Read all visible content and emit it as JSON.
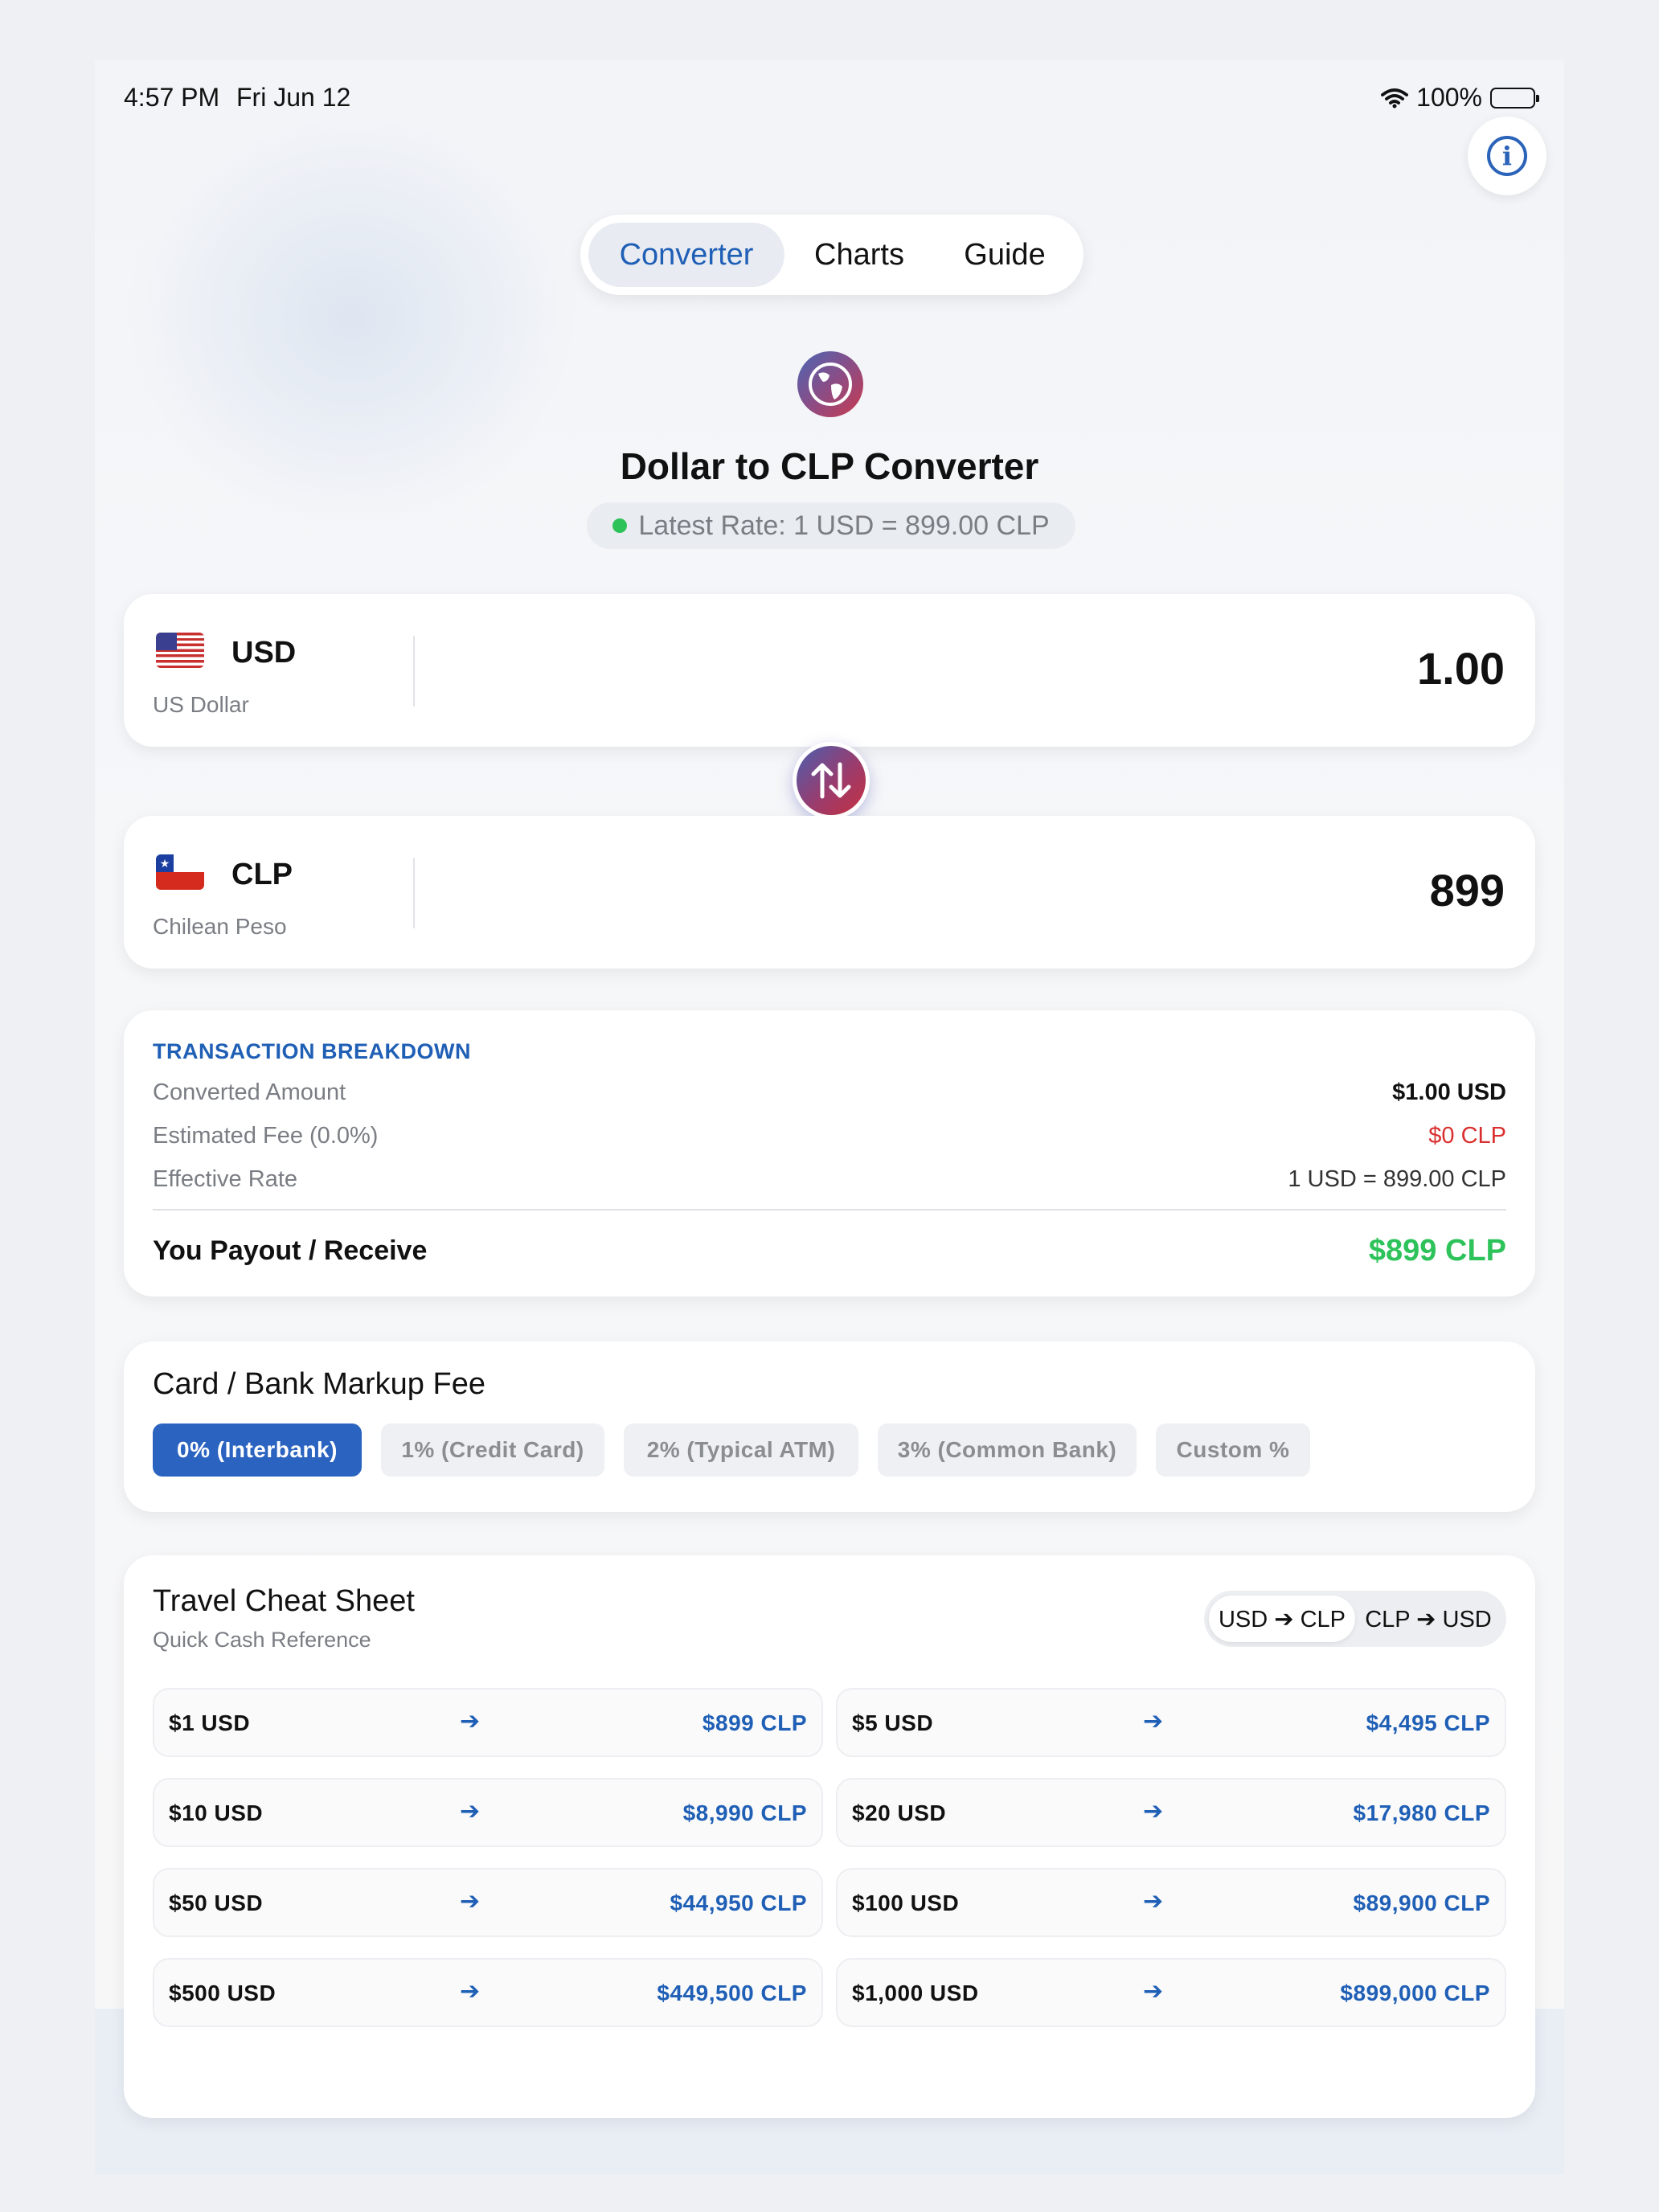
{
  "status_bar": {
    "time": "4:57 PM",
    "date": "Fri Jun 12",
    "battery": "100%"
  },
  "tabs": [
    {
      "label": "Converter",
      "active": true
    },
    {
      "label": "Charts",
      "active": false
    },
    {
      "label": "Guide",
      "active": false
    }
  ],
  "header": {
    "title": "Dollar to CLP Converter",
    "rate": "Latest Rate: 1 USD = 899.00 CLP"
  },
  "from_currency": {
    "code": "USD",
    "name": "US Dollar",
    "amount": "1.00"
  },
  "to_currency": {
    "code": "CLP",
    "name": "Chilean Peso",
    "amount": "899"
  },
  "breakdown": {
    "heading": "TRANSACTION BREAKDOWN",
    "rows": [
      {
        "label": "Converted Amount",
        "value": "$1.00 USD"
      },
      {
        "label": "Estimated Fee (0.0%)",
        "value": "$0 CLP"
      },
      {
        "label": "Effective Rate",
        "value": "1 USD = 899.00 CLP"
      }
    ],
    "total_label": "You Payout / Receive",
    "total_value": "$899 CLP"
  },
  "markup": {
    "title": "Card / Bank Markup Fee",
    "options": [
      "0% (Interbank)",
      "1% (Credit Card)",
      "2% (Typical ATM)",
      "3% (Common Bank)",
      "Custom %"
    ],
    "selected_index": 0
  },
  "cheat_sheet": {
    "title": "Travel Cheat Sheet",
    "subtitle": "Quick Cash Reference",
    "toggle": [
      "USD ➔ CLP",
      "CLP ➔ USD"
    ],
    "toggle_selected": 0,
    "rows": [
      {
        "from": "$1 USD",
        "to": "$899 CLP"
      },
      {
        "from": "$5 USD",
        "to": "$4,495 CLP"
      },
      {
        "from": "$10 USD",
        "to": "$8,990 CLP"
      },
      {
        "from": "$20 USD",
        "to": "$17,980 CLP"
      },
      {
        "from": "$50 USD",
        "to": "$44,950 CLP"
      },
      {
        "from": "$100 USD",
        "to": "$89,900 CLP"
      },
      {
        "from": "$500 USD",
        "to": "$449,500 CLP"
      },
      {
        "from": "$1,000 USD",
        "to": "$899,000 CLP"
      }
    ]
  },
  "colors": {
    "accent": "#1f5fb5",
    "positive": "#2ec25a",
    "fee": "#d9302f"
  }
}
